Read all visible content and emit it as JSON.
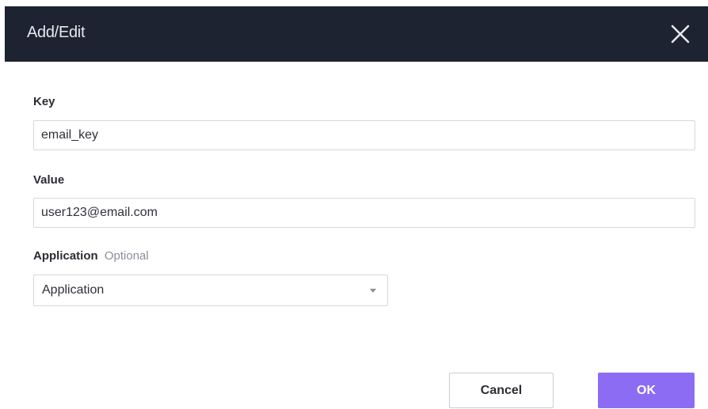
{
  "dialog": {
    "title": "Add/Edit",
    "close_icon": "close-icon"
  },
  "fields": {
    "key": {
      "label": "Key",
      "value": "email_key"
    },
    "value": {
      "label": "Value",
      "value": "user123@email.com"
    },
    "application": {
      "label": "Application",
      "optional_label": "Optional",
      "selected": "Application",
      "caret_icon": "chevron-down-icon"
    }
  },
  "buttons": {
    "cancel": "Cancel",
    "ok": "OK"
  },
  "colors": {
    "header_bg": "#1d2330",
    "primary": "#8b6cf3"
  }
}
